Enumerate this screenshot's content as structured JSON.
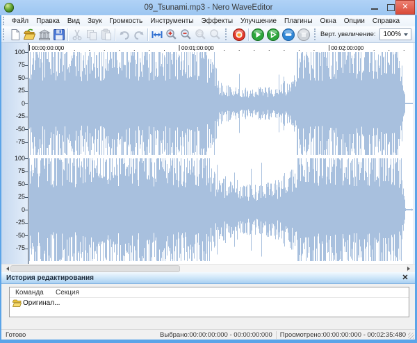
{
  "window": {
    "title": "09_Tsunami.mp3 - Nero WaveEditor",
    "controls": {
      "minimize": "minimize",
      "maximize": "maximize",
      "close": "close"
    }
  },
  "menu": {
    "keys": [
      "file",
      "edit",
      "view",
      "audio",
      "volume",
      "tools",
      "effects",
      "enhancement",
      "plugins",
      "windows",
      "options",
      "help"
    ],
    "items": [
      "Файл",
      "Правка",
      "Вид",
      "Звук",
      "Громкость",
      "Инструменты",
      "Эффекты",
      "Улучшение",
      "Плагины",
      "Окна",
      "Опции",
      "Справка"
    ]
  },
  "toolbar": {
    "icons": [
      "new-file",
      "open",
      "audio-library",
      "save",
      "cut",
      "copy",
      "paste",
      "undo",
      "redo",
      "fit-width",
      "zoom-in",
      "zoom-out",
      "zoom-selection",
      "zoom-full",
      "record",
      "play",
      "play-selection",
      "loop",
      "stop"
    ],
    "zoom_label": "Верт. увеличение:",
    "zoom_value": "100%"
  },
  "ruler": {
    "labels": [
      "00:00:00:000",
      "00:01:00:000",
      "00:02:00:000"
    ]
  },
  "scale": {
    "labels": [
      100,
      75,
      50,
      25,
      0,
      -25,
      -50,
      -75
    ]
  },
  "waveform": {
    "color": "#a8c0de",
    "envelope": [
      [
        0,
        0.96
      ],
      [
        0.46,
        0.96
      ],
      [
        0.475,
        0.7
      ],
      [
        0.5,
        0.4
      ],
      [
        0.545,
        0.3
      ],
      [
        0.6,
        0.3
      ],
      [
        0.64,
        0.34
      ],
      [
        0.675,
        0.42
      ],
      [
        0.693,
        0.55
      ],
      [
        0.7,
        1.0
      ],
      [
        0.708,
        1.0
      ],
      [
        0.716,
        0.92
      ],
      [
        0.73,
        0.96
      ],
      [
        0.965,
        0.96
      ],
      [
        0.975,
        0.5
      ],
      [
        0.982,
        0.015
      ],
      [
        1,
        0.015
      ]
    ],
    "quiet_range": [
      0.49,
      0.695
    ],
    "channels": [
      {
        "name": "left",
        "seed": 1234,
        "quiet_gain": 0.85
      },
      {
        "name": "right",
        "seed": 987,
        "quiet_gain": 1.3
      }
    ]
  },
  "history": {
    "title": "История редактирования",
    "columns": [
      "Команда",
      "Секция"
    ],
    "rows": [
      {
        "command": "Оригинал...",
        "icon": "folder-icon",
        "section": ""
      }
    ]
  },
  "status": {
    "ready": "Готово",
    "selected": "Выбрано:00:00:00:000 - 00:00:00:000",
    "viewed": "Просмотрено:00:00:00:000 - 00:02:35:480"
  }
}
